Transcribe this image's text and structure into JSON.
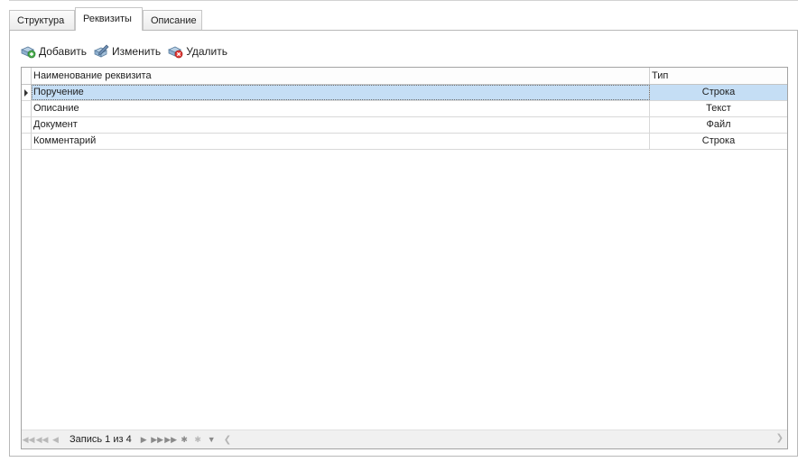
{
  "tabs": [
    {
      "label": "Структура",
      "active": false
    },
    {
      "label": "Реквизиты",
      "active": true
    },
    {
      "label": "Описание",
      "active": false
    }
  ],
  "toolbar": {
    "add_label": "Добавить",
    "edit_label": "Изменить",
    "delete_label": "Удалить"
  },
  "grid": {
    "columns": [
      "Наименование реквизита",
      "Тип"
    ],
    "rows": [
      {
        "name": "Поручение",
        "type": "Строка",
        "selected": true
      },
      {
        "name": "Описание",
        "type": "Текст",
        "selected": false
      },
      {
        "name": "Документ",
        "type": "Файл",
        "selected": false
      },
      {
        "name": "Комментарий",
        "type": "Строка",
        "selected": false
      }
    ]
  },
  "navigator": {
    "record_text": "Запись 1 из 4"
  },
  "colors": {
    "selection": "#c5def5",
    "border": "#a3a3a3",
    "navigator_bg": "#f0f0f0"
  }
}
